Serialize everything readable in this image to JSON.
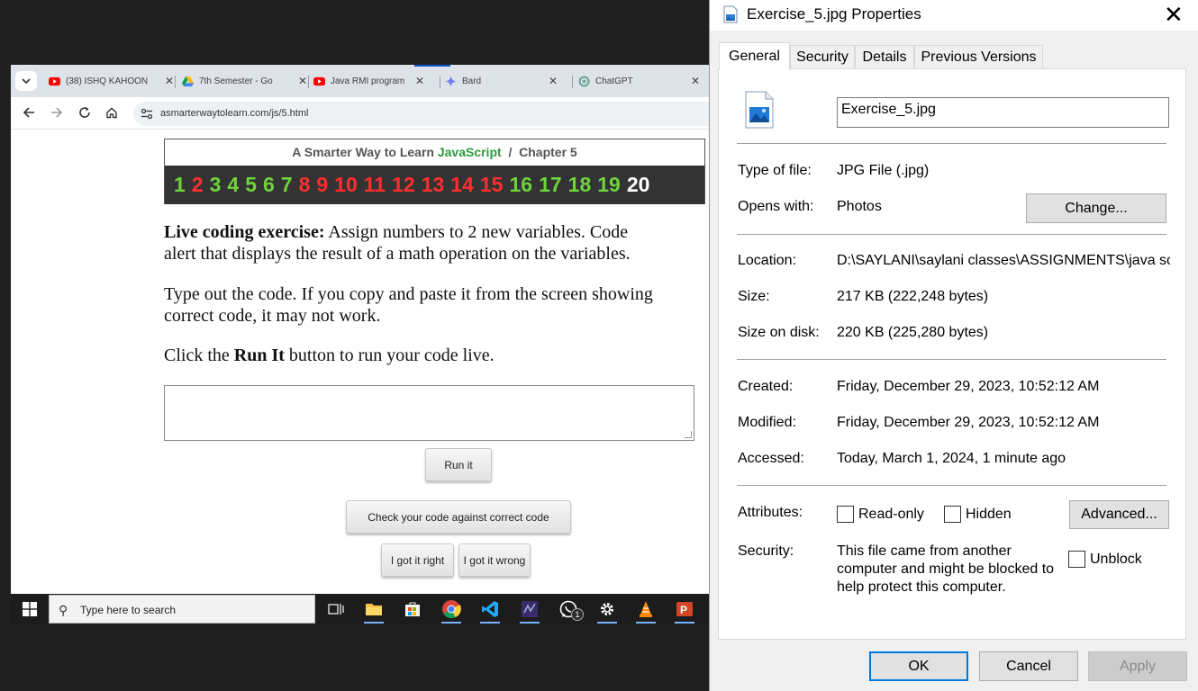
{
  "browser": {
    "tabs": [
      {
        "label": "(38) ISHQ KAHOON",
        "icon": "youtube-icon"
      },
      {
        "label": "7th Semester - Go",
        "icon": "google-drive-icon"
      },
      {
        "label": "Java RMI program",
        "icon": "youtube-icon"
      },
      {
        "label": "Bard",
        "icon": "bard-sparkle-icon"
      },
      {
        "label": "ChatGPT",
        "icon": "chatgpt-icon"
      }
    ],
    "tab_close": "✕",
    "url": "asmarterwaytolearn.com/js/5.html"
  },
  "page": {
    "chapter_header": {
      "prefix": "A Smarter Way to Learn ",
      "brand": "JavaScript",
      "suffix": "  /  Chapter 5"
    },
    "chapter_numbers": [
      {
        "n": "1",
        "color": "green"
      },
      {
        "n": "2",
        "color": "red"
      },
      {
        "n": "3",
        "color": "green"
      },
      {
        "n": "4",
        "color": "green"
      },
      {
        "n": "5",
        "color": "green"
      },
      {
        "n": "6",
        "color": "green"
      },
      {
        "n": "7",
        "color": "green"
      },
      {
        "n": "8",
        "color": "red"
      },
      {
        "n": "9",
        "color": "red"
      },
      {
        "n": "10",
        "color": "red"
      },
      {
        "n": "11",
        "color": "red"
      },
      {
        "n": "12",
        "color": "red"
      },
      {
        "n": "13",
        "color": "red"
      },
      {
        "n": "14",
        "color": "red"
      },
      {
        "n": "15",
        "color": "red"
      },
      {
        "n": "16",
        "color": "green"
      },
      {
        "n": "17",
        "color": "green"
      },
      {
        "n": "18",
        "color": "green"
      },
      {
        "n": "19",
        "color": "green"
      },
      {
        "n": "20",
        "color": "white"
      }
    ],
    "exercise_title": "Live coding exercise:",
    "exercise_line1": " Assign numbers to 2 new variables. Code",
    "exercise_line2": "alert that displays the result of a math operation on the variables.",
    "type_line1": "Type out the code. If you copy and paste it from the screen showing",
    "type_line2": "correct code, it may not work.",
    "click_pre": "Click the ",
    "click_bold": "Run It",
    "click_post": " button to run your code live.",
    "run_button": "Run it",
    "check_button": "Check your code against correct code",
    "right_button": "I got it right",
    "wrong_button": "I got it wrong"
  },
  "taskbar": {
    "search_placeholder": "Type here to search",
    "whatsapp_badge": "1"
  },
  "dialog": {
    "title": "Exercise_5.jpg Properties",
    "tabs": [
      "General",
      "Security",
      "Details",
      "Previous Versions"
    ],
    "filename": "Exercise_5.jpg",
    "type_label": "Type of file:",
    "type_value": "JPG File (.jpg)",
    "opens_label": "Opens with:",
    "opens_value": "Photos",
    "change_button": "Change...",
    "location_label": "Location:",
    "location_value": "D:\\SAYLANI\\saylani classes\\ASSIGNMENTS\\java sc",
    "size_label": "Size:",
    "size_value": "217 KB (222,248 bytes)",
    "disk_label": "Size on disk:",
    "disk_value": "220 KB (225,280 bytes)",
    "created_label": "Created:",
    "created_value": "Friday, December 29, 2023, 10:52:12 AM",
    "modified_label": "Modified:",
    "modified_value": "Friday, December 29, 2023, 10:52:12 AM",
    "accessed_label": "Accessed:",
    "accessed_value": "Today, March 1, 2024, 1 minute ago",
    "attributes_label": "Attributes:",
    "readonly_label": "Read-only",
    "hidden_label": "Hidden",
    "advanced_button": "Advanced...",
    "security_label": "Security:",
    "security_text": "This file came from another computer and might be blocked to help protect this computer.",
    "unblock_label": "Unblock",
    "ok_button": "OK",
    "cancel_button": "Cancel",
    "apply_button": "Apply"
  },
  "colors": {
    "accent": "#0078d7",
    "js_green": "#2a9d3a",
    "num_green": "#6fd33c",
    "num_red": "#ff2e2e"
  }
}
